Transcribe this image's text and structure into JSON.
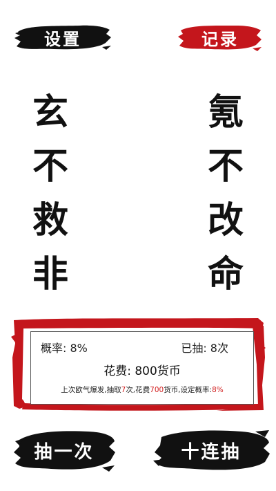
{
  "header": {
    "settings_label": "设置",
    "records_label": "记录"
  },
  "slogan": {
    "left": [
      "玄",
      "不",
      "救",
      "非"
    ],
    "right": [
      "氪",
      "不",
      "改",
      "命"
    ]
  },
  "stats": {
    "rate_label": "概率: 8%",
    "drawn_label": "已抽: 8次",
    "cost_label": "花费: 800货币",
    "last": {
      "prefix": "上次欧气爆发,抽取",
      "draws": "7",
      "mid1": "次,花费",
      "cost": "700",
      "mid2": "货币,设定概率:",
      "rate": "8%"
    }
  },
  "actions": {
    "single_label": "抽一次",
    "ten_label": "十连抽"
  },
  "colors": {
    "ink_black": "#111111",
    "seal_red": "#c4161c",
    "accent_red": "#d21f1f"
  }
}
